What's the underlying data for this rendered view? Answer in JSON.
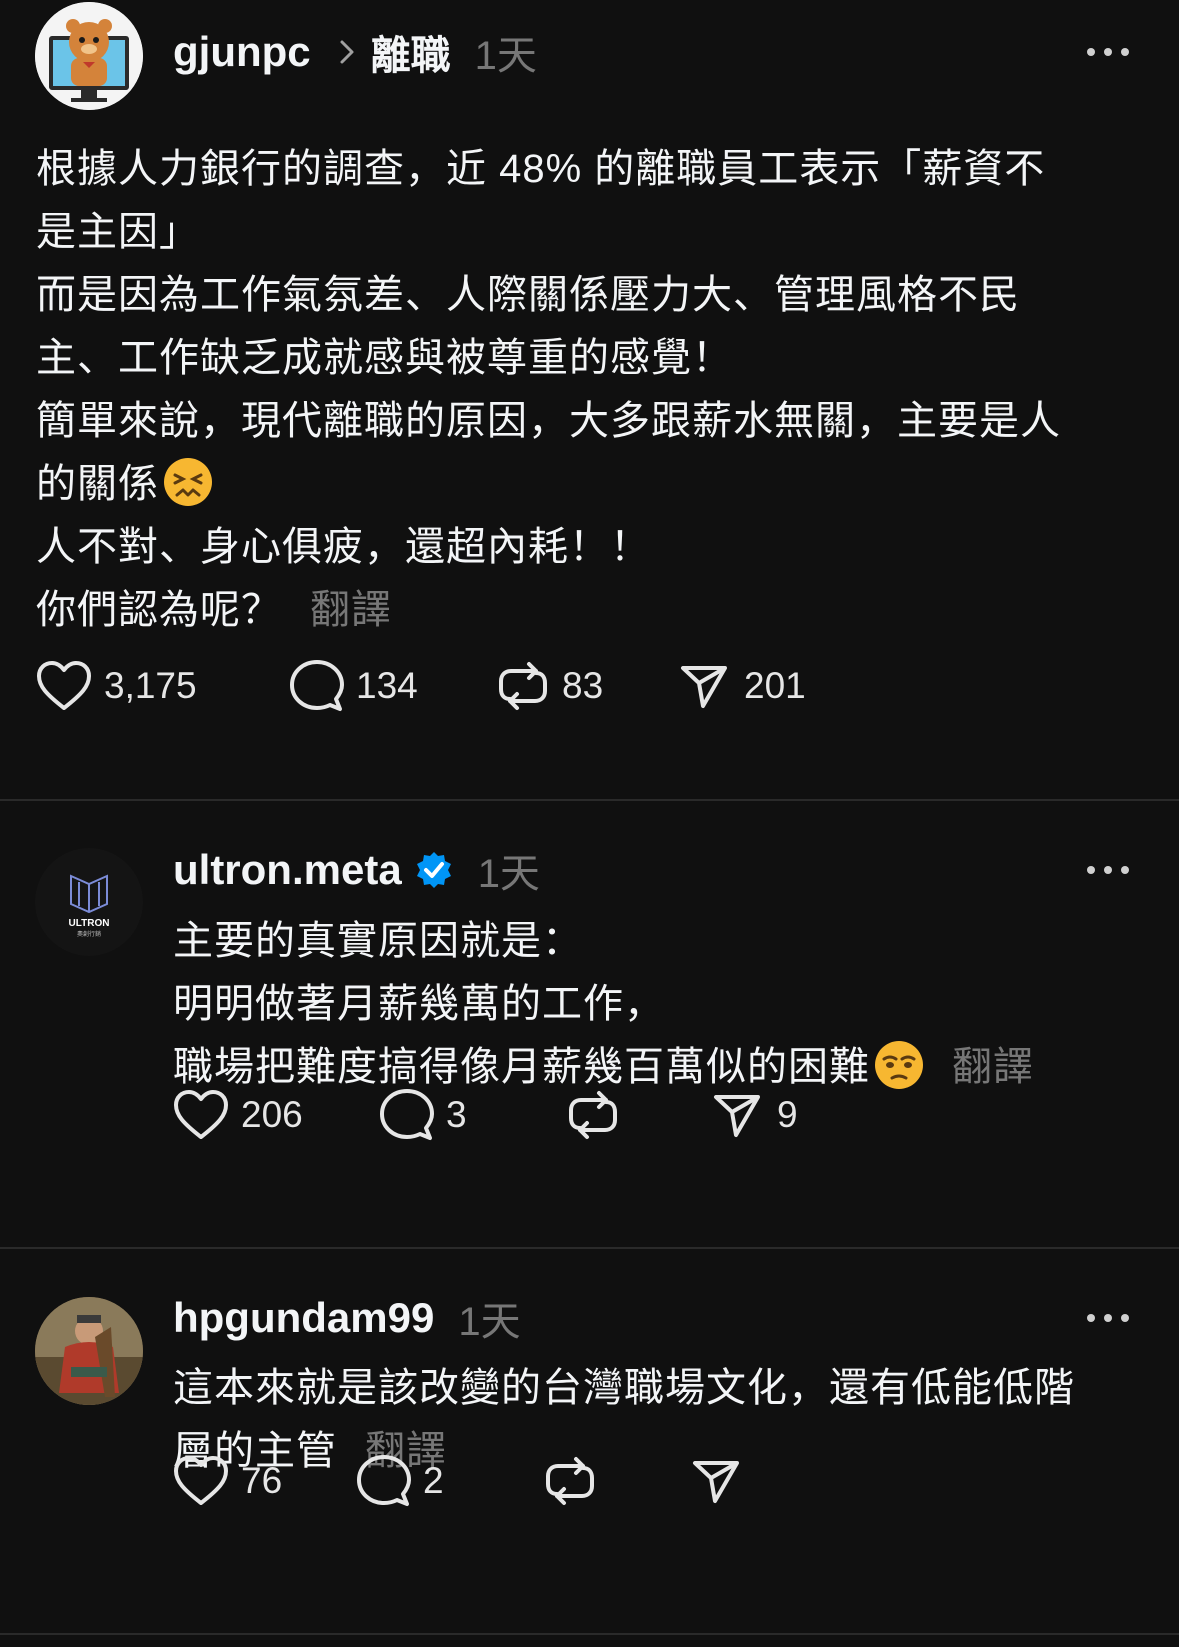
{
  "posts": [
    {
      "username": "gjunpc",
      "topic": "離職",
      "time": "1天",
      "lines": [
        "根據人力銀行的調查，近 48% 的離職員工表示「薪資不",
        "是主因」",
        "而是因為工作氣氛差、人際關係壓力大、管理風格不民",
        "主、工作缺乏成就感與被尊重的感覺！",
        "簡單來說，現代離職的原因，大多跟薪水無關，主要是人",
        "的關係",
        "人不對、身心俱疲，還超內耗！！",
        "你們認為呢？"
      ],
      "translate": "翻譯",
      "emoji": "confounded-face-emoji",
      "likes": "3,175",
      "comments": "134",
      "reposts": "83",
      "shares": "201"
    },
    {
      "username": "ultron.meta",
      "time": "1天",
      "verified": true,
      "lines": [
        "主要的真實原因就是：",
        "明明做著月薪幾萬的工作，",
        "職場把難度搞得像月薪幾百萬似的困難"
      ],
      "translate": "翻譯",
      "emoji": "pleading-face-emoji",
      "avatar_text": "ULTRON",
      "avatar_subtext": "奧創行銷",
      "likes": "206",
      "comments": "3",
      "reposts": "",
      "shares": "9"
    },
    {
      "username": "hpgundam99",
      "time": "1天",
      "lines": [
        "這本來就是該改變的台灣職場文化，還有低能低階",
        "層的主管"
      ],
      "translate": "翻譯",
      "likes": "76",
      "comments": "2",
      "reposts": "",
      "shares": ""
    }
  ],
  "colors": {
    "background": "#101010",
    "text": "#f3f5f7",
    "muted": "#777777",
    "divider": "#2a2a2a",
    "verified": "#0095f6"
  },
  "icons": {
    "like": "heart-icon",
    "comment": "comment-bubble-icon",
    "repost": "repost-icon",
    "share": "send-icon",
    "more": "more-dots-icon",
    "chevron": "chevron-right-icon",
    "verified": "verified-badge-icon"
  }
}
